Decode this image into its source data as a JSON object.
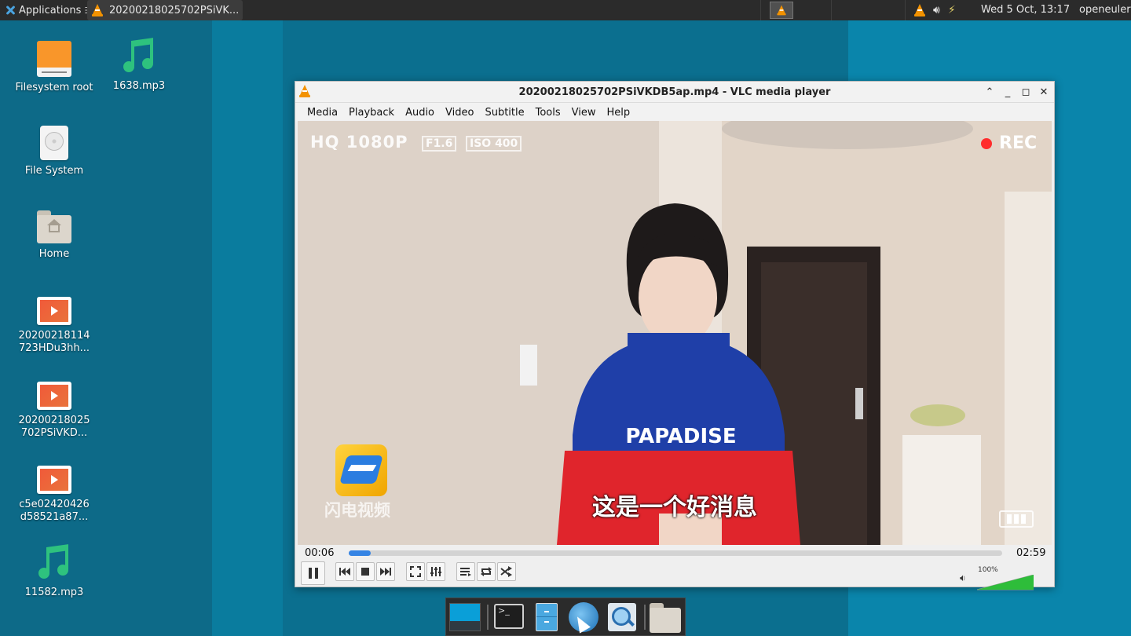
{
  "top_panel": {
    "applications_label": "Applications",
    "task_label": "20200218025702PSiVK...",
    "clock": "Wed  5 Oct, 13:17",
    "user": "openeuler"
  },
  "desktop_icons": [
    {
      "label": "Filesystem root",
      "icon": "drive-orange-icon"
    },
    {
      "label": "1638.mp3",
      "icon": "music-note-icon"
    },
    {
      "label": "File System",
      "icon": "hard-disk-icon"
    },
    {
      "label": "Home",
      "icon": "home-folder-icon"
    },
    {
      "label": "20200218114 723HDu3hh...",
      "icon": "video-file-icon"
    },
    {
      "label": "20200218025 702PSiVKD...",
      "icon": "video-file-icon"
    },
    {
      "label": "c5e02420426 d58521a87...",
      "icon": "video-file-icon"
    },
    {
      "label": "11582.mp3",
      "icon": "music-note-icon"
    }
  ],
  "vlc": {
    "title": "20200218025702PSiVKDB5ap.mp4 - VLC media player",
    "menu": [
      "Media",
      "Playback",
      "Audio",
      "Video",
      "Subtitle",
      "Tools",
      "View",
      "Help"
    ],
    "video": {
      "overlay_quality": "HQ 1080P",
      "overlay_f": "F1.6",
      "overlay_iso": "ISO 400",
      "overlay_rec": "REC",
      "shirt_text": "PAPADISE",
      "subtitle": "这是一个好消息",
      "watermark": "闪电视频"
    },
    "elapsed": "00:06",
    "total": "02:59",
    "progress_fraction": 0.034,
    "volume_label": "100%",
    "volume_fraction": 1.0
  },
  "colors": {
    "accent": "#3584e4",
    "vlc_orange": "#f39200",
    "volume_green": "#2ebd3a"
  }
}
